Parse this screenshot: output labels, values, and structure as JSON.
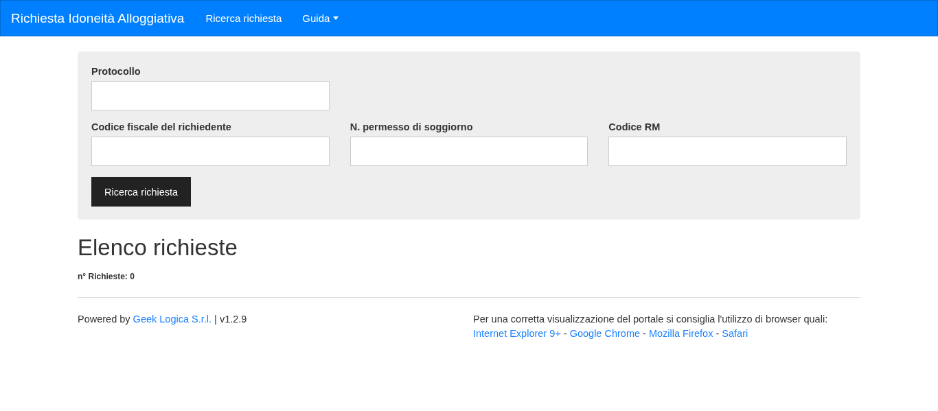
{
  "navbar": {
    "brand": "Richiesta Idoneità Alloggiativa",
    "items": [
      {
        "label": "Ricerca richiesta",
        "dropdown": false
      },
      {
        "label": "Guida",
        "dropdown": true
      }
    ]
  },
  "search_form": {
    "rows": [
      [
        {
          "label": "Protocollo"
        }
      ],
      [
        {
          "label": "Codice fiscale del richiedente"
        },
        {
          "label": "N. permesso di soggiorno"
        },
        {
          "label": "Codice RM"
        }
      ]
    ],
    "button": "Ricerca richiesta"
  },
  "results": {
    "title": "Elenco richieste",
    "count": "n° Richieste: 0"
  },
  "footer": {
    "left": {
      "before": "Powered by ",
      "link": "Geek Logica S.r.l.",
      "after": " | v1.2.9"
    },
    "notice": "Per una corretta visualizzazione del portale si consiglia l'utilizzo di browser quali:",
    "browsers": [
      {
        "kind": "link",
        "text": "Internet Explorer 9+"
      },
      {
        "kind": "separator",
        "text": "-"
      },
      {
        "kind": "link",
        "text": "Google Chrome"
      },
      {
        "kind": "separator",
        "text": "-"
      },
      {
        "kind": "link",
        "text": "Mozilla Firefox"
      },
      {
        "kind": "separator",
        "text": "-"
      },
      {
        "kind": "link",
        "text": "Safari"
      }
    ]
  }
}
